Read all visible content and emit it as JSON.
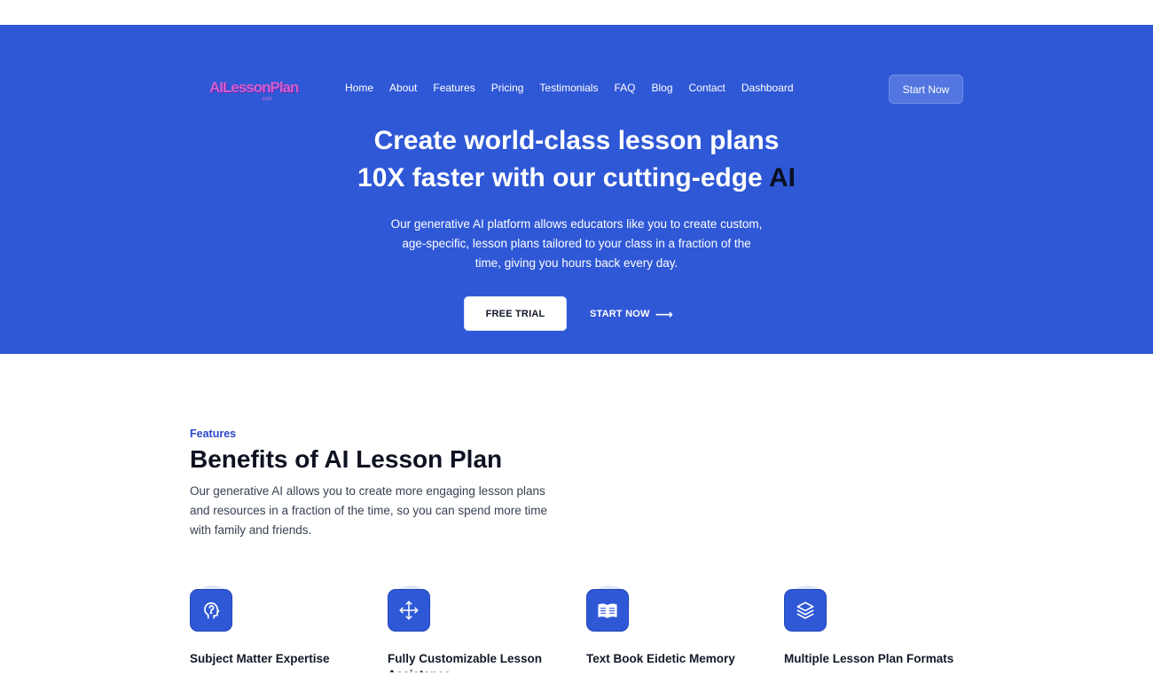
{
  "logo": {
    "text": "AILessonPlan",
    "subtext": ".com"
  },
  "nav": [
    {
      "label": "Home"
    },
    {
      "label": "About"
    },
    {
      "label": "Features"
    },
    {
      "label": "Pricing"
    },
    {
      "label": "Testimonials"
    },
    {
      "label": "FAQ"
    },
    {
      "label": "Blog"
    },
    {
      "label": "Contact"
    },
    {
      "label": "Dashboard"
    }
  ],
  "header": {
    "cta_label": "Start Now"
  },
  "hero": {
    "title_line1": "Create world-class lesson plans",
    "title_line2_prefix": "10X faster with our cutting-edge ",
    "title_line2_accent": "AI",
    "description": "Our generative AI platform allows educators like you to create custom, age-specific, lesson plans tailored to your class in a fraction of the time, giving you hours back every day.",
    "primary_cta": "FREE TRIAL",
    "secondary_cta": "START NOW",
    "arrow": "⟶"
  },
  "features": {
    "eyebrow": "Features",
    "title": "Benefits of AI Lesson Plan",
    "description": "Our generative AI allows you to create more engaging lesson plans and resources in a fraction of the time, so you can spend more time with family and friends.",
    "items": [
      {
        "title": "Subject Matter Expertise",
        "icon": "head-question-icon"
      },
      {
        "title": "Fully Customizable Lesson Assistance",
        "icon": "move-arrows-icon"
      },
      {
        "title": "Text Book Eidetic Memory",
        "icon": "open-book-icon"
      },
      {
        "title": "Multiple Lesson Plan Formats",
        "icon": "layers-icon"
      }
    ]
  },
  "colors": {
    "brand": "#2f58d6",
    "accent_text": "#0b1020",
    "eyebrow": "#2b45c9"
  }
}
